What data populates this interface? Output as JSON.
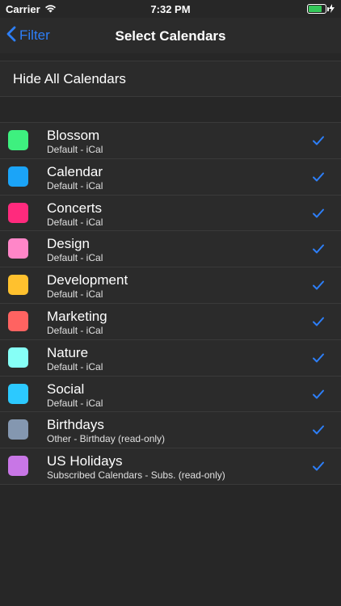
{
  "status": {
    "carrier": "Carrier",
    "time": "7:32 PM"
  },
  "nav": {
    "back_label": "Filter",
    "title": "Select Calendars"
  },
  "actions": {
    "hide_all": "Hide All Calendars"
  },
  "colors": {
    "accent": "#2d7ff9",
    "background": "#272727"
  },
  "calendars": [
    {
      "name": "Blossom",
      "detail": "Default - iCal",
      "color": "#3ef07f",
      "checked": true
    },
    {
      "name": "Calendar",
      "detail": "Default - iCal",
      "color": "#1ba4f8",
      "checked": true
    },
    {
      "name": "Concerts",
      "detail": "Default - iCal",
      "color": "#ff2a7d",
      "checked": true
    },
    {
      "name": "Design",
      "detail": "Default - iCal",
      "color": "#ff86c8",
      "checked": true
    },
    {
      "name": "Development",
      "detail": "Default - iCal",
      "color": "#ffc12e",
      "checked": true
    },
    {
      "name": "Marketing",
      "detail": "Default - iCal",
      "color": "#ff6361",
      "checked": true
    },
    {
      "name": "Nature",
      "detail": "Default - iCal",
      "color": "#86fff6",
      "checked": true
    },
    {
      "name": "Social",
      "detail": "Default - iCal",
      "color": "#2cc9ff",
      "checked": true
    },
    {
      "name": "Birthdays",
      "detail": "Other - Birthday (read-only)",
      "color": "#8497b0",
      "checked": true
    },
    {
      "name": "US Holidays",
      "detail": "Subscribed Calendars - Subs. (read-only)",
      "color": "#c876e6",
      "checked": true
    }
  ]
}
